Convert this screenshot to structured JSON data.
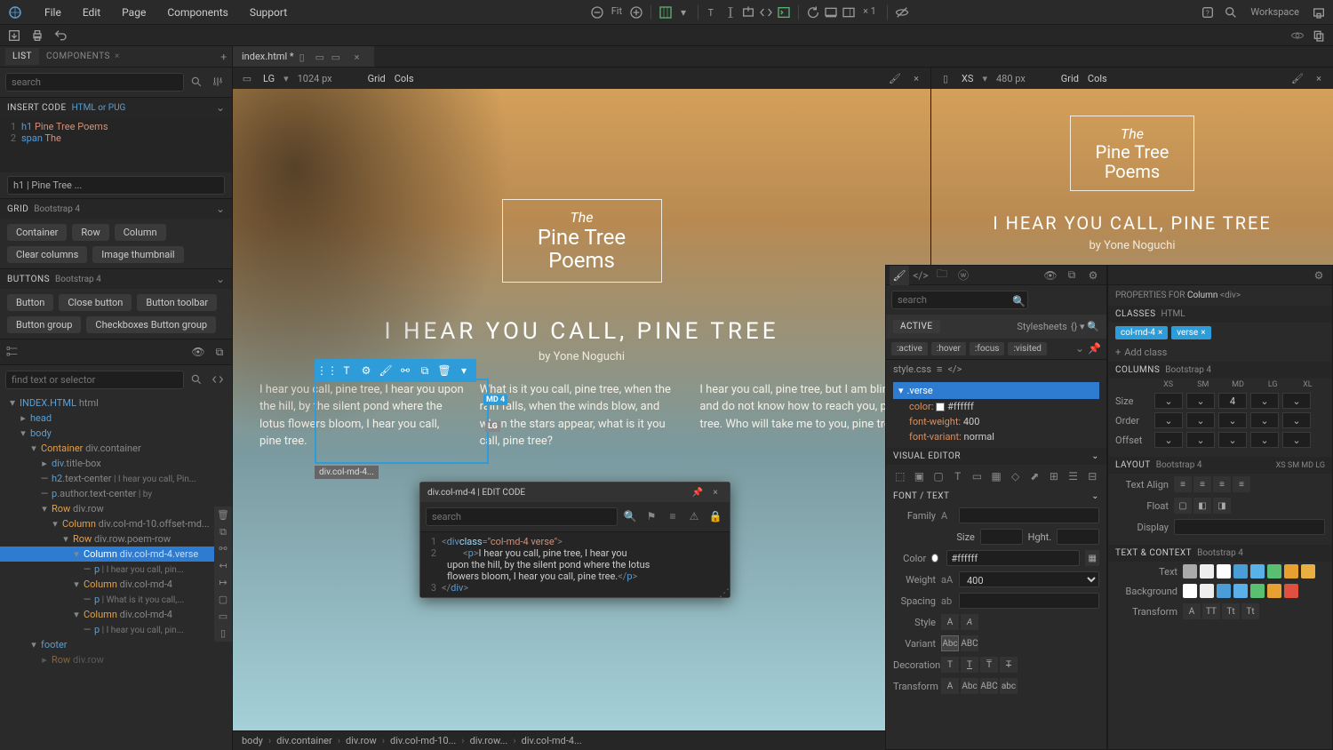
{
  "menubar": {
    "items": [
      "File",
      "Edit",
      "Page",
      "Components",
      "Support"
    ],
    "fit": "Fit",
    "scale": "× 1",
    "workspace": "Workspace"
  },
  "fileTab": {
    "name": "index.html *"
  },
  "leftPanel": {
    "tabs": {
      "list": "LIST",
      "components": "COMPONENTS"
    },
    "searchPlaceholder": "search",
    "insertCode": {
      "title": "INSERT CODE",
      "sub": "HTML or PUG"
    },
    "codeLines": [
      {
        "num": "1",
        "indent": "",
        "tokens": [
          [
            "tag",
            "h1"
          ],
          [
            "txt",
            "  Pine Tree Poems"
          ]
        ]
      },
      {
        "num": "2",
        "indent": "  ",
        "tokens": [
          [
            "tag",
            "span"
          ],
          [
            "txt",
            " The"
          ]
        ]
      }
    ],
    "codeBreadcrumb": "h1 | Pine Tree ...",
    "grid": {
      "title": "GRID",
      "sub": "Bootstrap 4",
      "chips": [
        "Container",
        "Row",
        "Column",
        "Clear columns",
        "Image thumbnail"
      ]
    },
    "buttons": {
      "title": "BUTTONS",
      "sub": "Bootstrap 4",
      "chips": [
        "Button",
        "Close button",
        "Button toolbar",
        "Button group",
        "Checkboxes Button group"
      ]
    },
    "findPlaceholder": "find text or selector",
    "fileHeader": {
      "name": "INDEX.HTML",
      "type": "html"
    },
    "tree": [
      {
        "indent": 1,
        "toggle": "▸",
        "dash": false,
        "label": "head",
        "cls": "",
        "text": ""
      },
      {
        "indent": 1,
        "toggle": "▾",
        "dash": false,
        "label": "body",
        "cls": "",
        "text": ""
      },
      {
        "indent": 2,
        "toggle": "▾",
        "dash": false,
        "label": "Container",
        "cls": " div.container",
        "text": ""
      },
      {
        "indent": 3,
        "toggle": "▸",
        "dash": false,
        "label": "div",
        "cls": ".title-box",
        "text": ""
      },
      {
        "indent": 3,
        "toggle": "",
        "dash": true,
        "label": "h2",
        "cls": ".text-center",
        "text": " | I hear you call, Pin..."
      },
      {
        "indent": 3,
        "toggle": "",
        "dash": true,
        "label": "p",
        "cls": ".author.text-center",
        "text": " | by"
      },
      {
        "indent": 3,
        "toggle": "▾",
        "dash": false,
        "label": "Row",
        "cls": " div.row",
        "text": ""
      },
      {
        "indent": 4,
        "toggle": "▾",
        "dash": false,
        "label": "Column",
        "cls": " div.col-md-10.offset-md...",
        "text": ""
      },
      {
        "indent": 5,
        "toggle": "▾",
        "dash": false,
        "label": "Row",
        "cls": " div.row.poem-row",
        "text": ""
      },
      {
        "indent": 6,
        "toggle": "▾",
        "dash": false,
        "label": "Column",
        "cls": " div.col-md-4.verse",
        "text": "",
        "selected": true
      },
      {
        "indent": 7,
        "toggle": "",
        "dash": true,
        "label": "p",
        "cls": "",
        "text": " | I hear you call, pin..."
      },
      {
        "indent": 6,
        "toggle": "▾",
        "dash": false,
        "label": "Column",
        "cls": " div.col-md-4",
        "text": ""
      },
      {
        "indent": 7,
        "toggle": "",
        "dash": true,
        "label": "p",
        "cls": "",
        "text": " | What is it you call,..."
      },
      {
        "indent": 6,
        "toggle": "▾",
        "dash": false,
        "label": "Column",
        "cls": " div.col-md-4",
        "text": ""
      },
      {
        "indent": 7,
        "toggle": "",
        "dash": true,
        "label": "p",
        "cls": "",
        "text": " | I hear you call, pin..."
      },
      {
        "indent": 2,
        "toggle": "▾",
        "dash": false,
        "label": "footer",
        "cls": "",
        "text": ""
      },
      {
        "indent": 3,
        "toggle": "▸",
        "dash": false,
        "label": "Row",
        "cls": " div.row",
        "text": "",
        "faded": true
      }
    ]
  },
  "canvasLG": {
    "label": "LG",
    "px": "1024 px",
    "grid": "Grid",
    "cols": "Cols"
  },
  "canvasXS": {
    "label": "XS",
    "px": "480 px",
    "grid": "Grid",
    "cols": "Cols"
  },
  "page": {
    "the": "The",
    "title": "Pine Tree Poems",
    "heading": "I HEAR YOU CALL, PINE TREE",
    "author": "by Yone Noguchi",
    "verses": [
      "I hear you call, pine tree, I hear you upon the hill, by the silent pond where the lotus flowers bloom, I hear you call, pine tree.",
      "What is it you call, pine tree, when the rain falls, when the winds blow, and when the stars appear, what is it you call, pine tree?",
      "I hear you call, pine tree, but I am blind, and do not know how to reach you, pine tree. Who will take me to you, pine tree?"
    ]
  },
  "selTag": "div.col-md-4...",
  "bpBadges": {
    "md": "MD 4",
    "lg": "LG"
  },
  "popup": {
    "title": "div.col-md-4 | EDIT CODE",
    "searchPlaceholder": "search",
    "lines": [
      {
        "num": "1",
        "html": "<div class=\"col-md-4 verse\">"
      },
      {
        "num": "2",
        "html": "    <p>I hear you call, pine tree, I hear you upon the hill, by the silent pond where the lotus flowers bloom, I hear you call, pine tree.</p>"
      },
      {
        "num": "3",
        "html": "</div>"
      }
    ]
  },
  "cssPanel": {
    "searchPlaceholder": "search",
    "active": "ACTIVE",
    "stylesheets": "Stylesheets",
    "pseudo": [
      ":active",
      ":hover",
      ":focus",
      ":visited"
    ],
    "file": "style.css",
    "selector": ".verse",
    "decls": [
      {
        "prop": "color:",
        "val": "#ffffff",
        "swatch": "#ffffff"
      },
      {
        "prop": "font-weight:",
        "val": "400"
      },
      {
        "prop": "font-variant:",
        "val": "normal"
      }
    ],
    "visualEditor": "VISUAL EDITOR",
    "fontText": "FONT / TEXT",
    "labels": {
      "family": "Family",
      "size": "Size",
      "hght": "Hght.",
      "color": "Color",
      "weight": "Weight",
      "spacing": "Spacing",
      "style": "Style",
      "variant": "Variant",
      "decoration": "Decoration",
      "transform": "Transform"
    },
    "colorVal": "#ffffff",
    "weightVal": "400",
    "variantBtns": [
      "Abc",
      "ABC"
    ],
    "transformBtns": [
      "A",
      "Abc",
      "ABC",
      "abc"
    ]
  },
  "propsPanel": {
    "titlePrefix": "PROPERTIES FOR ",
    "elname": "Column",
    "eltag": "<div>",
    "classesHdr": "CLASSES",
    "classesSub": "HTML",
    "classes": [
      "col-md-4",
      "verse"
    ],
    "addClass": "Add class",
    "columnsHdr": "COLUMNS",
    "columnsSub": "Bootstrap 4",
    "bps": [
      "XS",
      "SM",
      "MD",
      "LG",
      "XL"
    ],
    "rows": [
      "Size",
      "Order",
      "Offset"
    ],
    "mdSize": "4",
    "layoutHdr": "LAYOUT",
    "layoutSub": "Bootstrap 4",
    "layoutBps": [
      "XS",
      "SM",
      "MD",
      "LG"
    ],
    "textAlign": "Text Align",
    "float": "Float",
    "display": "Display",
    "textContextHdr": "TEXT & CONTEXT",
    "textContextSub": "Bootstrap 4",
    "textLabel": "Text",
    "bgLabel": "Background",
    "transformLabel": "Transform",
    "transformBtns": [
      "A",
      "TT",
      "Tt",
      "Tt"
    ],
    "textColors": [
      "#aaaaaa",
      "#eeeeee",
      "#ffffff",
      "#4a9ed8",
      "#5ab0e8",
      "#58c070",
      "#e8a030",
      "#e8b040"
    ],
    "bgColors": [
      "#ffffff",
      "#eeeeee",
      "#4a9ed8",
      "#5ab0e8",
      "#58c070",
      "#e8a030",
      "#e05040"
    ]
  },
  "breadcrumb": [
    "body",
    "div.container",
    "div.row",
    "div.col-md-10...",
    "div.row...",
    "div.col-md-4..."
  ]
}
